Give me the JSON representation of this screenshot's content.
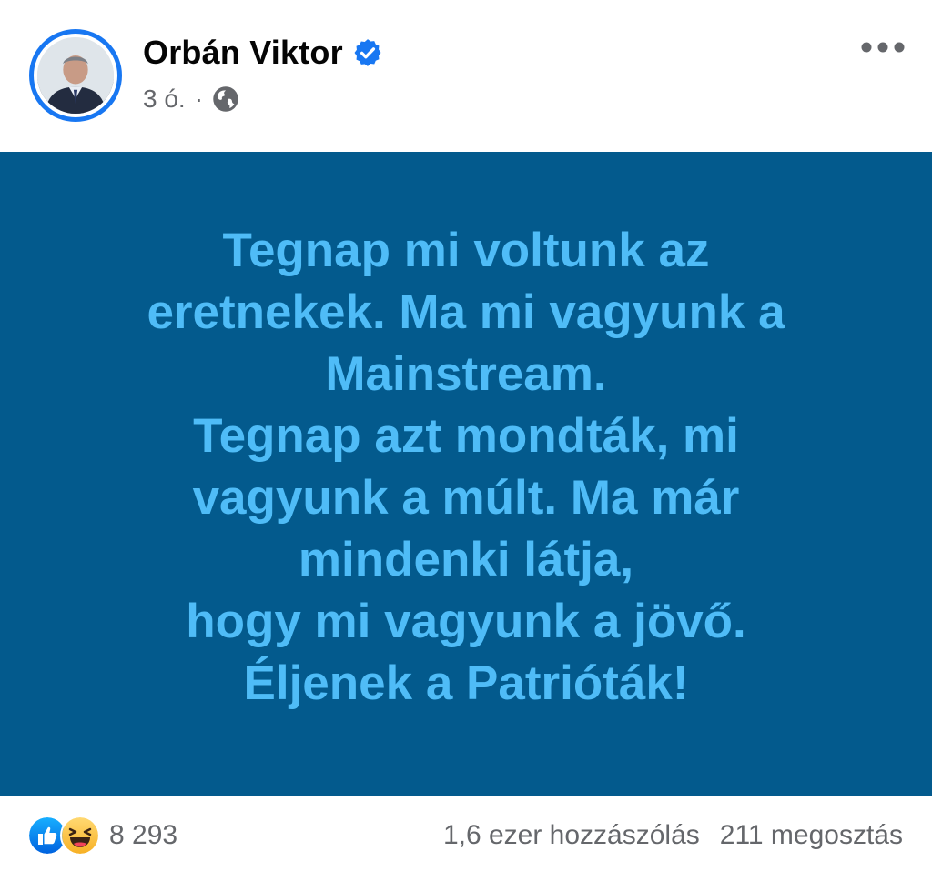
{
  "post": {
    "author": {
      "name": "Orbán Viktor",
      "verified": true,
      "avatar_icon": "profile-photo"
    },
    "meta": {
      "time": "3 ó.",
      "separator": "·",
      "audience_icon": "globe-icon"
    },
    "more_icon": "more-options-icon",
    "content": {
      "text": "Tegnap mi voltunk az\neretnekek. Ma mi vagyunk a\nMainstream.\nTegnap azt mondták, mi\nvagyunk a múlt. Ma már\nmindenki látja,\nhogy mi vagyunk a jövő.\nÉljenek a Patrióták!",
      "background_color": "#035a8d",
      "text_color": "#4fbcf7"
    },
    "footer": {
      "reaction_icons": [
        "like-icon",
        "haha-icon"
      ],
      "reaction_count": "8 293",
      "comments": "1,6 ezer hozzászólás",
      "shares": "211 megosztás"
    }
  },
  "colors": {
    "accent": "#1877f2",
    "muted_text": "#65676b"
  }
}
